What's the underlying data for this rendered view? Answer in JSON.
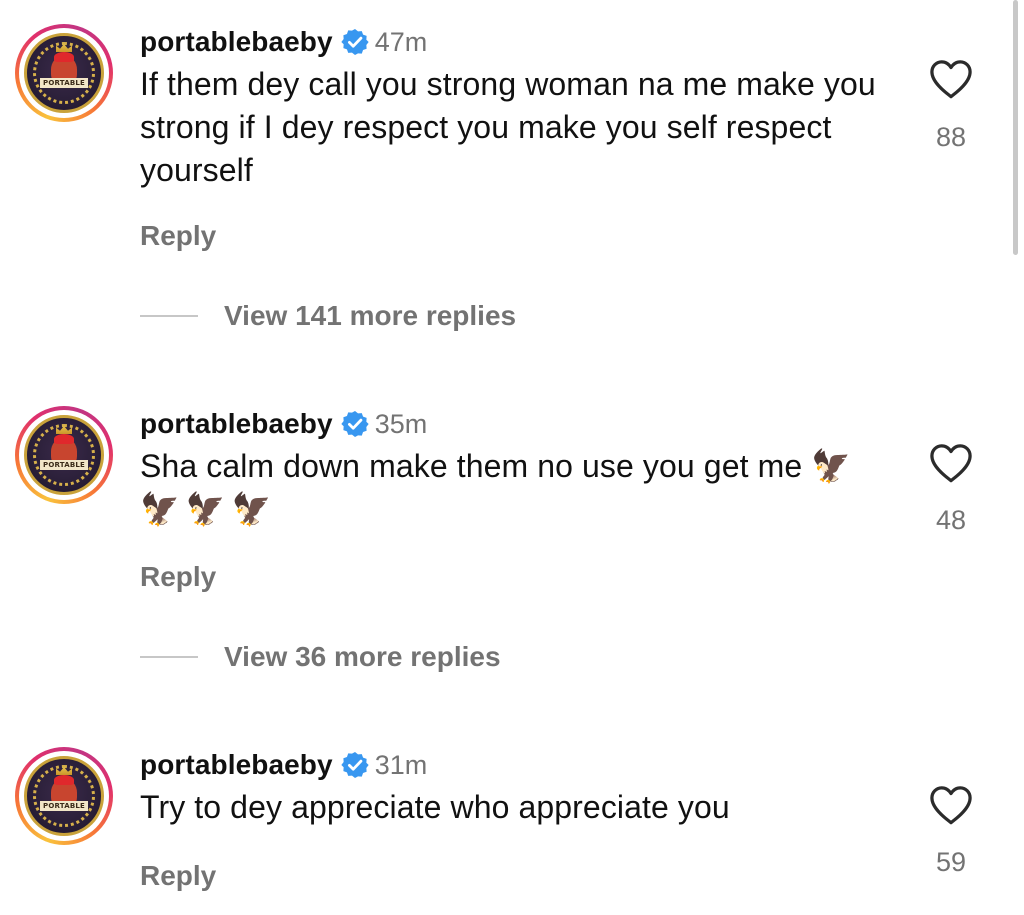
{
  "comments": [
    {
      "username": "portablebaeby",
      "time": "47m",
      "text": "If them dey call you strong woman na me make you strong if I dey respect you make you self respect yourself",
      "reply_label": "Reply",
      "likes": "88",
      "view_replies": "View 141 more replies"
    },
    {
      "username": "portablebaeby",
      "time": "35m",
      "text": "Sha calm down make them no use you get me",
      "emoji": "🦅🦅🦅🦅",
      "reply_label": "Reply",
      "likes": "48",
      "view_replies": "View 36 more replies"
    },
    {
      "username": "portablebaeby",
      "time": "31m",
      "text": "Try to dey appreciate who appreciate you",
      "reply_label": "Reply",
      "likes": "59"
    }
  ],
  "avatar_badge": "PORTABLE",
  "icons": {
    "verified": "verified-badge-icon",
    "like": "heart-outline-icon"
  },
  "colors": {
    "verified_blue": "#3897f0",
    "secondary_text": "#737373",
    "primary_text": "#111111"
  }
}
